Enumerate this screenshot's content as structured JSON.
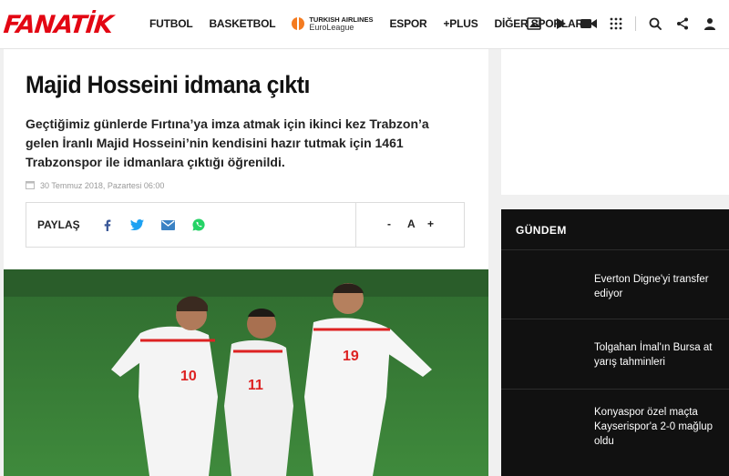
{
  "header": {
    "logo": "FANATİK",
    "nav": [
      "FUTBOL",
      "BASKETBOL",
      "ESPOR",
      "+PLUS",
      "DİĞER SPORLAR"
    ],
    "euroleague_line1": "TURKISH AIRLINES",
    "euroleague_line2": "EuroLeague"
  },
  "article": {
    "title": "Majid Hosseini idmana çıktı",
    "lead": "Geçtiğimiz günlerde Fırtına’ya imza atmak için ikinci kez Trabzon’a gelen İranlı Majid Hosseini’nin kendisini hazır tutmak için 1461 Trabzonspor ile idmanlara çıktığı öğrenildi.",
    "date": "30 Temmuz 2018, Pazartesi 06:00",
    "share_label": "PAYLAŞ",
    "font_minus": "-",
    "font_a": "A",
    "font_plus": "+",
    "jersey_numbers": [
      "10",
      "11",
      "19"
    ]
  },
  "gundem": {
    "title": "GÜNDEM",
    "items": [
      "Everton Digne'yi transfer ediyor",
      "Tolgahan İmal'ın Bursa at yarış tahminleri",
      "Konyaspor özel maçta Kayserispor'a 2-0 mağlup oldu"
    ]
  },
  "colors": {
    "brand": "#e30613",
    "facebook": "#3b5998",
    "twitter": "#1da1f2",
    "mail": "#3b82c4",
    "whatsapp": "#25d366"
  },
  "icons": [
    "gallery-icon",
    "play-icon",
    "video-camera-icon",
    "grid-icon",
    "search-icon",
    "share-icon",
    "user-icon",
    "calendar-icon",
    "facebook-icon",
    "twitter-icon",
    "mail-icon",
    "whatsapp-icon"
  ]
}
